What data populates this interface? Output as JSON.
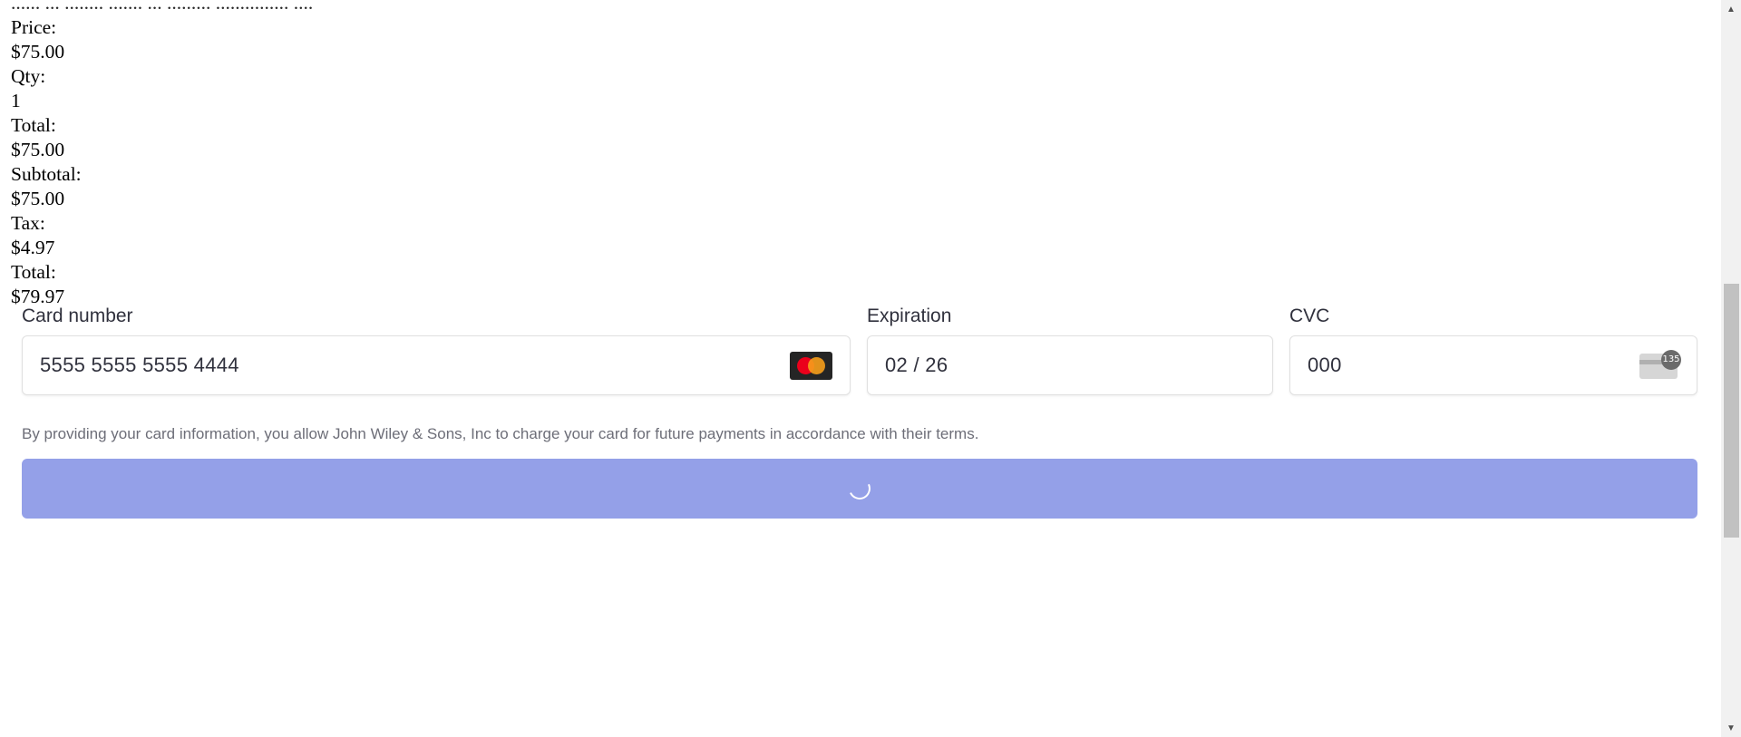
{
  "summary": {
    "cut_line": "...... ... ........ ....... ... ......... ............... ....",
    "price_label": "Price:",
    "price_value": "$75.00",
    "qty_label": "Qty:",
    "qty_value": "1",
    "line_total_label": "Total:",
    "line_total_value": "$75.00",
    "subtotal_label": "Subtotal:",
    "subtotal_value": "$75.00",
    "tax_label": "Tax:",
    "tax_value": "$4.97",
    "grand_total_label": "Total:",
    "grand_total_value": "$79.97"
  },
  "payment": {
    "card_number_label": "Card number",
    "card_number_value": "5555 5555 5555 4444",
    "card_brand_icon": "mastercard-icon",
    "expiration_label": "Expiration",
    "expiration_value": "02 / 26",
    "cvc_label": "CVC",
    "cvc_value": "000",
    "cvc_icon": "cvc-card-icon",
    "cvc_badge": "135",
    "terms_text": "By providing your card information, you allow John Wiley & Sons, Inc to charge your card for future payments in accordance with their terms.",
    "submit_state": "loading",
    "submit_color": "#94a0e8"
  },
  "scrollbar": {
    "up_arrow": "▲",
    "down_arrow": "▼"
  }
}
